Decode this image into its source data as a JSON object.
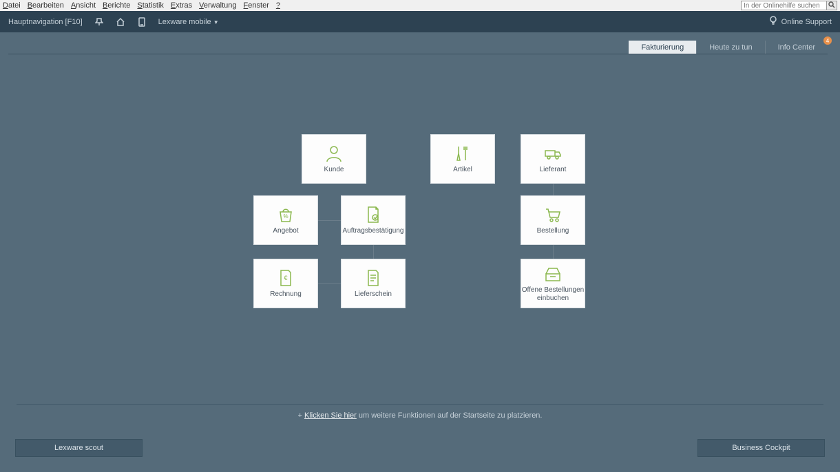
{
  "menubar": {
    "items": [
      {
        "prefix": "D",
        "rest": "atei"
      },
      {
        "prefix": "B",
        "rest": "earbeiten"
      },
      {
        "prefix": "A",
        "rest": "nsicht"
      },
      {
        "prefix": "B",
        "rest": "erichte"
      },
      {
        "prefix": "S",
        "rest": "tatistik"
      },
      {
        "prefix": "E",
        "rest": "xtras"
      },
      {
        "prefix": "V",
        "rest": "erwaltung"
      },
      {
        "prefix": "F",
        "rest": "enster"
      },
      {
        "prefix": "?",
        "rest": ""
      }
    ],
    "search_placeholder": "In der Onlinehilfe suchen"
  },
  "toolbar": {
    "nav_label": "Hauptnavigation [F10]",
    "mobile_label": "Lexware mobile",
    "support_label": "Online Support"
  },
  "tabs": {
    "active": "Fakturierung",
    "todo": "Heute zu tun",
    "info": "Info Center",
    "badge_count": "4"
  },
  "tiles": {
    "kunde": "Kunde",
    "artikel": "Artikel",
    "lieferant": "Lieferant",
    "angebot": "Angebot",
    "auftragsbestaetigung": "Auftragsbestätigung",
    "bestellung": "Bestellung",
    "rechnung": "Rechnung",
    "lieferschein": "Lieferschein",
    "offene_bestellungen": "Offene Bestellungen einbuchen"
  },
  "hint": {
    "plus": "+",
    "link": "Klicken Sie hier",
    "suffix": " um weitere Funktionen auf der Startseite zu platzieren."
  },
  "footer": {
    "scout": "Lexware scout",
    "cockpit": "Business Cockpit"
  }
}
